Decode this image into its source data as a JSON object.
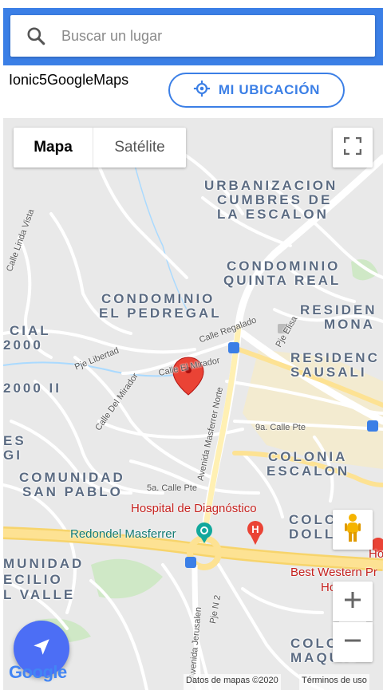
{
  "search": {
    "placeholder": "Buscar un lugar",
    "value": ""
  },
  "app": {
    "title": "Ionic5GoogleMaps",
    "locate_label": "MI UBICACIÓN"
  },
  "map": {
    "type_options": [
      "Mapa",
      "Satélite"
    ],
    "selected_type": "Mapa",
    "areas": {
      "urb_l1": "URBANIZACION",
      "urb_l2": "CUMBRES DE",
      "urb_l3": "LA ESCALON",
      "cond_qr_l1": "CONDOMINIO",
      "cond_qr_l2": "QUINTA REAL",
      "cond_ped_l1": "CONDOMINIO",
      "cond_ped_l2": "EL PEDREGAL",
      "resid_mona_l1": "RESIDEN",
      "resid_mona_l2": "MONA",
      "resid_saus_l1": "RESIDENC",
      "resid_saus_l2": "SAUSALI",
      "cial_1": "CIAL",
      "cial_2": "2000",
      "cial_3": "2000 II",
      "left_gi_1": "ES",
      "left_gi_2": "GI",
      "col_esc_l1": "COLONIA",
      "col_esc_l2": "ESCALON",
      "com_sp_l1": "COMUNIDAD",
      "com_sp_l2": "SAN PABLO",
      "col_dol_l1": "COLC",
      "col_dol_l2": "DOLL",
      "cecilio_l1": "MUNIDAD",
      "cecilio_l2": "ECILIO",
      "cecilio_l3": "L VALLE",
      "col_maq_l1": "COLC",
      "col_maq_l2": "MAQUIL"
    },
    "streets": {
      "linda_vista": "Calle Linda Vista",
      "libertad": "Pje Libertad",
      "mirador": "Calle El Mirador",
      "del_mirador": "Calle Del Mirador",
      "masferrer_norte": "Avenida Masferrer Norte",
      "calle_9a": "9a. Calle Pte",
      "calle_5a": "5a. Calle Pte",
      "elisa": "Pje Elisa",
      "calle_regalado": "Calle Regalado",
      "jerusalen": "Avenida Jerusalen",
      "pje_n2": "Pje N 2"
    },
    "poi": {
      "hospital": "Hospital de Diagnóstico",
      "redondel": "Redondel Masferrer",
      "best_western_1": "Ho",
      "best_western_2": "Best Western Pr",
      "best_western_3": "Ho"
    },
    "footer": {
      "logo": "Google",
      "data_attribution": "Datos de mapas ©2020",
      "terms": "Términos de uso"
    },
    "colors": {
      "primary": "#3b7fe6",
      "fab": "#4c6ef5",
      "marker": "#ea4335"
    }
  }
}
